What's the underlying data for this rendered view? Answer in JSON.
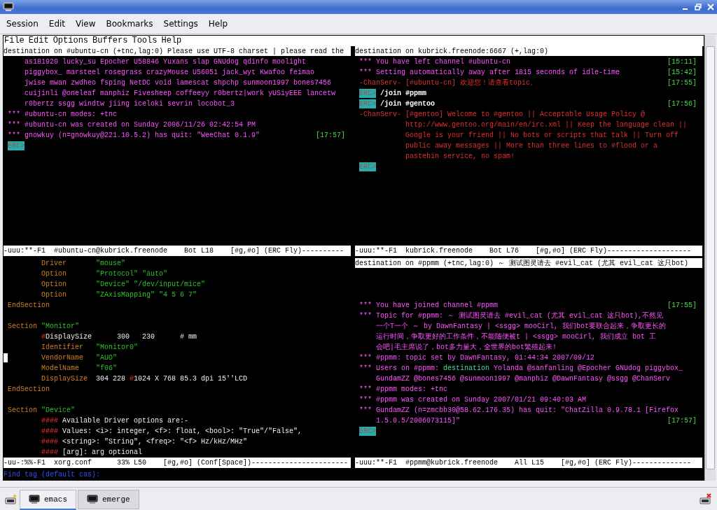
{
  "window": {
    "menu": [
      "Session",
      "Edit",
      "View",
      "Bookmarks",
      "Settings",
      "Help"
    ]
  },
  "emacs_menu": [
    "File",
    "Edit",
    "Options",
    "Buffers",
    "Tools",
    "Help"
  ],
  "panes": [
    {
      "header": "destination on #ubuntu-cn (+tnc,lag:0) Please use UTF-8 charset | please read the",
      "lines": [
        {
          "kind": "wrap",
          "segs": [
            {
              "kind": "sys",
              "text": "as181920 lucky_su Epocher U58846 Yuxans slap GNUdog qdinfo moolight"
            }
          ]
        },
        {
          "kind": "wrap",
          "segs": [
            {
              "kind": "sys",
              "text": "piggybox_ marsteel rosegrass crazyMouse U56051 jack_wyt Kwafoo feimao"
            }
          ]
        },
        {
          "kind": "wrap",
          "segs": [
            {
              "kind": "sys",
              "text": "jwise mwan zwdheo fsping NetDC void lamescat shpchp sunmoon1997 bones7456"
            }
          ]
        },
        {
          "kind": "wrap",
          "segs": [
            {
              "kind": "sys",
              "text": "cuijinli @oneleaf manphiz Fivesheep coffeeyy r0bertz|work yUSiyEEE lancetw"
            }
          ]
        },
        {
          "kind": "wrap",
          "segs": [
            {
              "kind": "sys",
              "text": "r0bertz ssgg windtw jiing iceloki sevrin locobot_3"
            }
          ]
        },
        {
          "kind": "line",
          "segs": [
            {
              "kind": "sys",
              "text": "*** #ubuntu-cn modes: +tnc"
            }
          ]
        },
        {
          "kind": "line",
          "segs": [
            {
              "kind": "sys",
              "text": "*** #ubuntu-cn was created on Sunday 2006/11/26 02:42:54 PM"
            }
          ]
        },
        {
          "kind": "line",
          "segs": [
            {
              "kind": "sys",
              "text": "*** gnowkuy (n=gnowkuy@221.10.5.2) has quit: \"WeeChat 0.1.9\""
            }
          ],
          "time": "[17:57]"
        },
        {
          "kind": "line",
          "prompt": "ERC>"
        }
      ],
      "mode_line": "-uuu:**-F1  #ubuntu-cn@kubrick.freenode    Bot L18    [#g,#o] (ERC Fly)----------"
    },
    {
      "header": "destination on kubrick.freenode:6667 (+,lag:0)",
      "lines": [
        {
          "kind": "line",
          "segs": [
            {
              "kind": "sys",
              "text": "*** You have left channel #ubuntu-cn"
            }
          ],
          "time": "[15:11]"
        },
        {
          "kind": "line",
          "segs": [
            {
              "kind": "sys",
              "text": "*** Setting automatically away after 1815 seconds of idle-time"
            }
          ],
          "time": "[15:42]"
        },
        {
          "kind": "line",
          "segs": [
            {
              "kind": "notice",
              "text": "-ChanServ- [#ubuntu-cn] 欢迎您！请查看topic。"
            }
          ],
          "time": "[17:55]"
        },
        {
          "kind": "line",
          "prompt": "ERC>",
          "segs": [
            {
              "kind": "input",
              "text": "/join #ppmm"
            }
          ]
        },
        {
          "kind": "line",
          "prompt": "ERC>",
          "segs": [
            {
              "kind": "input",
              "text": "/join #gentoo"
            }
          ],
          "time": "[17:56]"
        },
        {
          "kind": "line",
          "segs": [
            {
              "kind": "notice",
              "text": "-ChanServ- [#gentoo] Welcome to #gentoo || Acceptable Usage Policy @"
            }
          ]
        },
        {
          "kind": "hang",
          "segs": [
            {
              "kind": "notice",
              "text": "http://www.gentoo.org/main/en/irc.xml || Keep the language clean ||"
            }
          ]
        },
        {
          "kind": "hang",
          "segs": [
            {
              "kind": "notice",
              "text": "Google is your friend || No bots or scripts that talk || Turn off"
            }
          ]
        },
        {
          "kind": "hang",
          "segs": [
            {
              "kind": "notice",
              "text": "public away messages || More than three lines to #flood or a"
            }
          ]
        },
        {
          "kind": "hang",
          "segs": [
            {
              "kind": "notice",
              "text": "pastebin service, no spam!"
            }
          ]
        },
        {
          "kind": "line",
          "prompt": "ERC>"
        }
      ],
      "mode_line": "-uuu:**-F1  kubrick.freenode    Bot L76    [#g,#o] (ERC Fly)--------------------"
    },
    {
      "lines": [
        {
          "kind": "tab",
          "cursor": false,
          "segs": [
            {
              "kind": "key",
              "text": "Driver"
            },
            {
              "kind": "str",
              "text": "\"mouse\""
            }
          ]
        },
        {
          "kind": "tab",
          "cursor": false,
          "segs": [
            {
              "kind": "key",
              "text": "Option"
            },
            {
              "kind": "str",
              "text": "\"Protocol\" \"auto\""
            }
          ]
        },
        {
          "kind": "tab",
          "cursor": false,
          "segs": [
            {
              "kind": "key",
              "text": "Option"
            },
            {
              "kind": "str",
              "text": "\"Device\" \"/dev/input/mice\""
            }
          ]
        },
        {
          "kind": "tab",
          "cursor": false,
          "segs": [
            {
              "kind": "key",
              "text": "Option"
            },
            {
              "kind": "str",
              "text": "\"ZAxisMapping\" \"4 5 6 7\""
            }
          ]
        },
        {
          "kind": "line",
          "cursor": false,
          "segs": [
            {
              "kind": "kw",
              "text": "EndSection"
            }
          ]
        },
        {
          "kind": "blank",
          "cursor": false
        },
        {
          "kind": "line",
          "cursor": false,
          "segs": [
            {
              "kind": "kw",
              "text": "Section"
            },
            {
              "kind": "str",
              "text": " \"Monitor\""
            }
          ]
        },
        {
          "kind": "tab",
          "cursor": false,
          "segs": [
            {
              "kind": "comment",
              "text": "#"
            },
            {
              "kind": "plain",
              "text": "DisplaySize      300   230      # mm"
            }
          ]
        },
        {
          "kind": "tab",
          "cursor": false,
          "segs": [
            {
              "kind": "key",
              "text": "Identifier"
            },
            {
              "kind": "str",
              "text": "\"Monitor0\""
            }
          ]
        },
        {
          "kind": "tab",
          "cursor": true,
          "segs": [
            {
              "kind": "key",
              "text": "VendorName"
            },
            {
              "kind": "str",
              "text": "\"AUO\""
            }
          ]
        },
        {
          "kind": "tab",
          "cursor": false,
          "segs": [
            {
              "kind": "key",
              "text": "ModelName"
            },
            {
              "kind": "str",
              "text": "\"f06\""
            }
          ]
        },
        {
          "kind": "tab",
          "cursor": false,
          "segs": [
            {
              "kind": "key",
              "text": "DisplaySize"
            },
            {
              "kind": "plain",
              "text": "304 228 "
            },
            {
              "kind": "comment",
              "text": "#"
            },
            {
              "kind": "plain",
              "text": "1024 X 768 85.3 dpi 15''LCD"
            }
          ]
        },
        {
          "kind": "line",
          "cursor": false,
          "segs": [
            {
              "kind": "kw",
              "text": "EndSection"
            }
          ]
        },
        {
          "kind": "blank",
          "cursor": false
        },
        {
          "kind": "line",
          "cursor": false,
          "segs": [
            {
              "kind": "kw",
              "text": "Section"
            },
            {
              "kind": "str",
              "text": " \"Device\""
            }
          ]
        },
        {
          "kind": "tab",
          "cursor": false,
          "segs": [
            {
              "kind": "comment",
              "text": "####"
            },
            {
              "kind": "plain",
              "text": " Available Driver options are:-"
            }
          ]
        },
        {
          "kind": "tab",
          "cursor": false,
          "segs": [
            {
              "kind": "comment",
              "text": "####"
            },
            {
              "kind": "plain",
              "text": " Values: <i>: integer, <f>: float, <bool>: \"True\"/\"False\","
            }
          ]
        },
        {
          "kind": "tab",
          "cursor": false,
          "segs": [
            {
              "kind": "comment",
              "text": "####"
            },
            {
              "kind": "plain",
              "text": " <string>: \"String\", <freq>: \"<f> Hz/kHz/MHz\""
            }
          ]
        },
        {
          "kind": "tab",
          "cursor": false,
          "segs": [
            {
              "kind": "comment",
              "text": "####"
            },
            {
              "kind": "plain",
              "text": " [arg]: arg optional"
            }
          ]
        }
      ],
      "mode_line": "-uu-:%%-F1  xorg.conf      33% L50    [#g,#o] (Conf[Space])-----------------------"
    },
    {
      "header": "destination on #ppmm (+tnc,lag:0) ～ 测试图灵请去 #evil_cat (尤其 evil_cat 这只bot)",
      "lines": [
        {
          "kind": "blank"
        },
        {
          "kind": "blank"
        },
        {
          "kind": "blank"
        },
        {
          "kind": "line",
          "segs": [
            {
              "kind": "sys",
              "text": "*** You have joined channel #ppmm"
            }
          ],
          "time": "[17:55]"
        },
        {
          "kind": "line",
          "segs": [
            {
              "kind": "sys",
              "text": "*** Topic for #ppmm: ～ 测试图灵请去 #evil_cat (尤其 evil_cat 这只bot),不然见"
            }
          ]
        },
        {
          "kind": "wrap",
          "segs": [
            {
              "kind": "sys",
              "text": "一个T一个 ～ by DawnFantasy | <ssgg> mooCirl, 我们bot要联合起来，争取更长的"
            }
          ]
        },
        {
          "kind": "wrap",
          "segs": [
            {
              "kind": "sys",
              "text": "运行时间，争取更好的工作条件，不能随便被t | <ssgg> mooCirl, 我们成立 bot 工"
            }
          ]
        },
        {
          "kind": "wrap",
          "segs": [
            {
              "kind": "sys",
              "text": "会吧|毛主席说了，bot多力量大，全世界的bot繁殖起来!"
            }
          ]
        },
        {
          "kind": "line",
          "segs": [
            {
              "kind": "sys",
              "text": "*** #ppmm: topic set by DawnFantasy, 01:44:34 2007/09/12"
            }
          ]
        },
        {
          "kind": "line",
          "segs": [
            {
              "kind": "sys",
              "text": "*** Users on #ppmm: "
            },
            {
              "kind": "nick",
              "text": "destination"
            },
            {
              "kind": "sys",
              "text": " Yolanda @sanfanling @Epocher GNUdog piggybox_"
            }
          ]
        },
        {
          "kind": "wrap",
          "segs": [
            {
              "kind": "sys",
              "text": "GundamZZ @bones7456 @sunmoon1997 @manphiz @DawnFantasy @ssgg @ChanServ"
            }
          ]
        },
        {
          "kind": "line",
          "segs": [
            {
              "kind": "sys",
              "text": "*** #ppmm modes: +tnc"
            }
          ]
        },
        {
          "kind": "line",
          "segs": [
            {
              "kind": "sys",
              "text": "*** #ppmm was created on Sunday 2007/01/21 09:40:03 AM"
            }
          ]
        },
        {
          "kind": "line",
          "segs": [
            {
              "kind": "sys",
              "text": "*** GundamZZ (n=zmcbb30@58.62.176.35) has quit: \"ChatZilla 0.9.78.1 [Firefox"
            }
          ]
        },
        {
          "kind": "wrap",
          "segs": [
            {
              "kind": "sys",
              "text": "1.5.0.5/2006073115]\""
            }
          ],
          "time": "[17:57]"
        },
        {
          "kind": "line",
          "prompt": "ERC>"
        }
      ],
      "mode_line": "-uuu:**-F1  #ppmm@kubrick.freenode    All L15    [#g,#o] (ERC Fly)--------------"
    }
  ],
  "minibuffer": "Find tag (default cas):",
  "taskbar": {
    "tabs": [
      {
        "label": "emacs",
        "selected": true
      },
      {
        "label": "emerge",
        "selected": false
      }
    ]
  }
}
